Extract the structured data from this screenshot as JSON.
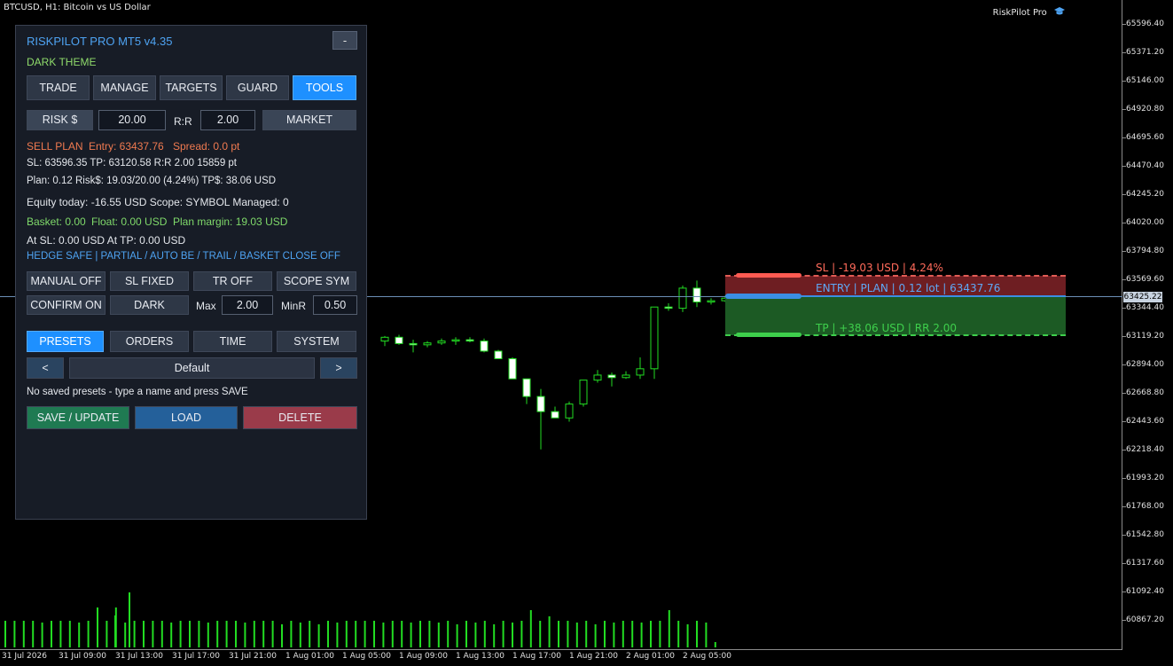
{
  "chart": {
    "title": "BTCUSD, H1:  Bitcoin vs US Dollar",
    "plugin_name": "RiskPilot Pro",
    "current_price": "63425.22",
    "price_labels": [
      "65596.40",
      "65371.20",
      "65146.00",
      "64920.80",
      "64695.60",
      "64470.40",
      "64245.20",
      "64020.00",
      "63794.80",
      "63569.60",
      "63344.40",
      "63119.20",
      "62894.00",
      "62668.80",
      "62443.60",
      "62218.40",
      "61993.20",
      "61768.00",
      "61542.80",
      "61317.60",
      "61092.40",
      "60867.20"
    ],
    "time_labels": [
      "31 Jul 2026",
      "31 Jul 09:00",
      "31 Jul 13:00",
      "31 Jul 17:00",
      "31 Jul 21:00",
      "1 Aug 01:00",
      "1 Aug 05:00",
      "1 Aug 09:00",
      "1 Aug 13:00",
      "1 Aug 17:00",
      "1 Aug 21:00",
      "2 Aug 01:00",
      "2 Aug 05:00"
    ],
    "colors": {
      "bull": "#ffffff",
      "bear": "#ffffff",
      "wick": "#22dd22",
      "volume": "#22dd22",
      "sl": "#ff5b52",
      "entry": "#3b8ee3",
      "tp": "#3ecf4c"
    },
    "candles": [
      [
        63080,
        63120,
        63040,
        63110
      ],
      [
        63110,
        63130,
        63050,
        63060
      ],
      [
        63060,
        63090,
        62990,
        63050
      ],
      [
        63050,
        63080,
        63030,
        63065
      ],
      [
        63065,
        63100,
        63050,
        63080
      ],
      [
        63080,
        63110,
        63050,
        63090
      ],
      [
        63090,
        63110,
        63070,
        63080
      ],
      [
        63080,
        63100,
        62990,
        63000
      ],
      [
        63000,
        63010,
        62970,
        62940
      ],
      [
        62940,
        62950,
        62800,
        62780
      ],
      [
        62780,
        62650,
        62580,
        62640
      ],
      [
        62640,
        62700,
        62220,
        62520
      ],
      [
        62520,
        62560,
        62480,
        62470
      ],
      [
        62470,
        62600,
        62440,
        62580
      ],
      [
        62580,
        62760,
        62560,
        62770
      ],
      [
        62770,
        62850,
        62750,
        62810
      ],
      [
        62810,
        62830,
        62720,
        62790
      ],
      [
        62790,
        62840,
        62780,
        62810
      ],
      [
        62810,
        62950,
        62780,
        62860
      ],
      [
        62860,
        63340,
        62780,
        63350
      ],
      [
        63350,
        63380,
        63320,
        63340
      ],
      [
        63340,
        63520,
        63310,
        63500
      ],
      [
        63500,
        63560,
        63350,
        63390
      ],
      [
        63390,
        63420,
        63370,
        63400
      ],
      [
        63400,
        63440,
        63390,
        63420
      ],
      [
        63420,
        63440,
        63400,
        63425
      ]
    ],
    "volumes": [
      0.3,
      0.3,
      0.3,
      0.3,
      0.28,
      0.3,
      0.3,
      0.3,
      0.28,
      0.3,
      0.45,
      0.3,
      0.45,
      0.28,
      0.3,
      0.3,
      0.3,
      0.3,
      0.28,
      0.3,
      0.3,
      0.3,
      0.28,
      0.3,
      0.3,
      0.3,
      0.28,
      0.3,
      0.3,
      0.3,
      0.26,
      0.3,
      0.28,
      0.3,
      0.26,
      0.3,
      0.28,
      0.3,
      0.3,
      0.3,
      0.3,
      0.28,
      0.3,
      0.3,
      0.28,
      0.3,
      0.3,
      0.28,
      0.3,
      0.26,
      0.3,
      0.28,
      0.3,
      0.26,
      0.3,
      0.28,
      0.3,
      0.42,
      0.3,
      0.35,
      0.3,
      0.3,
      0.28,
      0.3,
      0.26,
      0.3,
      0.28,
      0.3,
      0.3,
      0.28,
      0.3,
      0.3,
      0.42,
      0.3,
      0.26,
      0.3,
      0.28,
      0.06
    ],
    "volume_extra": [
      0.36,
      0.62
    ]
  },
  "zones": {
    "sl_text": "SL  |  -19.03 USD  |  4.24%",
    "entry_text": "ENTRY  |  PLAN  |  0.12 lot  |  63437.76",
    "tp_text": "TP  |  +38.06 USD  |  RR 2.00"
  },
  "panel": {
    "title": "RISKPILOT PRO MT5   v4.35",
    "collapse_label": "-",
    "theme_label": "DARK THEME",
    "tabs": [
      "TRADE",
      "MANAGE",
      "TARGETS",
      "GUARD",
      "TOOLS"
    ],
    "risk_button": "RISK $",
    "risk_value": "20.00",
    "rr_label": "R:R",
    "rr_value": "2.00",
    "market_button": "MARKET",
    "plan_side": "SELL PLAN",
    "plan_entry": "Entry: 63437.76",
    "plan_spread": "Spread: 0.0 pt",
    "line_sl_tp": "SL: 63596.35    TP: 63120.58    R:R 2.00    15859 pt",
    "line_plan": "Plan: 0.12    Risk$: 19.03/20.00 (4.24%)    TP$: 38.06 USD",
    "line_equity": "Equity today: -16.55 USD    Scope: SYMBOL    Managed: 0",
    "basket": "Basket: 0.00",
    "float": "Float: 0.00 USD",
    "plan_margin": "Plan margin: 19.03 USD",
    "line_at": "At SL: 0.00 USD     At TP: 0.00 USD",
    "flags": "HEDGE SAFE | PARTIAL / AUTO BE / TRAIL / BASKET CLOSE OFF",
    "btn_manual": "MANUAL OFF",
    "btn_sl_fixed": "SL FIXED",
    "btn_tr": "TR OFF",
    "btn_scope": "SCOPE SYM",
    "btn_confirm": "CONFIRM ON",
    "btn_dark": "DARK",
    "max_label": "Max",
    "max_value": "2.00",
    "minr_label": "MinR",
    "minr_value": "0.50",
    "sub_tabs": [
      "PRESETS",
      "ORDERS",
      "TIME",
      "SYSTEM"
    ],
    "prev_label": "<",
    "preset_name": "Default",
    "next_label": ">",
    "preset_note": "No saved presets - type a name and press SAVE",
    "btn_save": "SAVE / UPDATE",
    "btn_load": "LOAD",
    "btn_delete": "DELETE",
    "colors": {
      "save": "#1f7a52",
      "load": "#24609a",
      "delete": "#9a3b4a",
      "tab_active": "#1e90ff"
    }
  }
}
